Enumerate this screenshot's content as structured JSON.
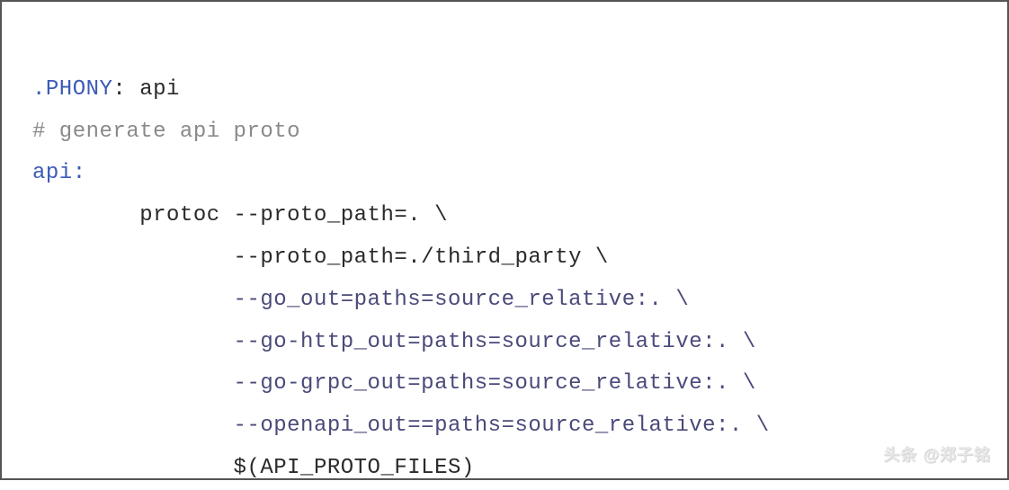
{
  "code": {
    "line1_phony": ".PHONY",
    "line1_colon": ":",
    "line1_val": " api",
    "line2_comment": "# generate api proto",
    "line3_target": "api:",
    "line4": "        protoc --proto_path=. \\",
    "line5": "               --proto_path=./third_party \\",
    "line6": "               --go_out=paths=source_relative:. \\",
    "line7": "               --go-http_out=paths=source_relative:. \\",
    "line8": "               --go-grpc_out=paths=source_relative:. \\",
    "line9": "               --openapi_out==paths=source_relative:. \\",
    "line10": "               $(API_PROTO_FILES)"
  },
  "watermark": "头条 @郑子铭"
}
